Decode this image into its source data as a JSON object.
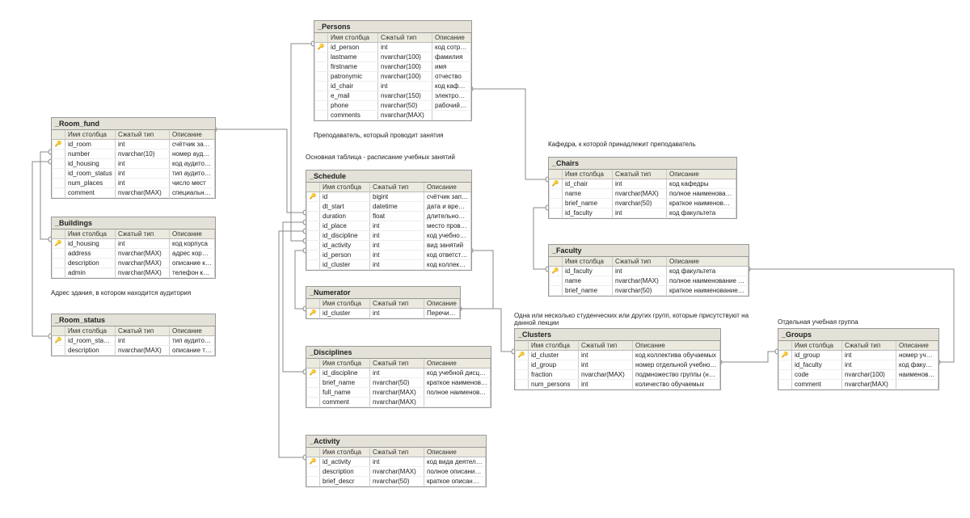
{
  "columns_header": {
    "name": "Имя столбца",
    "type": "Сжатый тип",
    "desc": "Описание"
  },
  "captions": {
    "buildings": "Адрес здания, в котором находится аудитория",
    "persons": "Преподаватель, который проводит занятия",
    "schedule": "Основная таблица - расписание учебных занятий",
    "chairs": "Кафедра, к которой принадлежит преподаватель",
    "clusters": "Одна или несколько студенческих или других групп, которые присутствуют на данной лекции",
    "groups": "Отдельная учебная группа"
  },
  "tables": {
    "room_fund": {
      "title": "_Room_fund",
      "rows": [
        {
          "pk": true,
          "name": "id_room",
          "type": "int",
          "desc": "счётчик записей"
        },
        {
          "pk": false,
          "name": "number",
          "type": "nvarchar(10)",
          "desc": "номер аудитории"
        },
        {
          "pk": false,
          "name": "id_housing",
          "type": "int",
          "desc": "код аудитории"
        },
        {
          "pk": false,
          "name": "id_room_status",
          "type": "int",
          "desc": "тип аудитории"
        },
        {
          "pk": false,
          "name": "num_places",
          "type": "int",
          "desc": "число мест"
        },
        {
          "pk": false,
          "name": "comment",
          "type": "nvarchar(MAX)",
          "desc": "специальное наи…"
        }
      ]
    },
    "buildings": {
      "title": "_Buildings",
      "rows": [
        {
          "pk": true,
          "name": "id_housing",
          "type": "int",
          "desc": "код корпуса"
        },
        {
          "pk": false,
          "name": "address",
          "type": "nvarchar(MAX)",
          "desc": "адрес корпуса"
        },
        {
          "pk": false,
          "name": "description",
          "type": "nvarchar(MAX)",
          "desc": "описание корпуса"
        },
        {
          "pk": false,
          "name": "admin",
          "type": "nvarchar(MAX)",
          "desc": "телефон коменданта или…"
        }
      ]
    },
    "room_status": {
      "title": "_Room_status",
      "rows": [
        {
          "pk": true,
          "name": "id_room_sta…",
          "type": "int",
          "desc": "тип аудитории"
        },
        {
          "pk": false,
          "name": "description",
          "type": "nvarchar(MAX)",
          "desc": "описание типа аудитории…"
        }
      ]
    },
    "persons": {
      "title": "_Persons",
      "rows": [
        {
          "pk": true,
          "name": "id_person",
          "type": "int",
          "desc": "код сотрудника"
        },
        {
          "pk": false,
          "name": "lastname",
          "type": "nvarchar(100)",
          "desc": "фамилия"
        },
        {
          "pk": false,
          "name": "firstname",
          "type": "nvarchar(100)",
          "desc": "имя"
        },
        {
          "pk": false,
          "name": "patronymic",
          "type": "nvarchar(100)",
          "desc": "отчество"
        },
        {
          "pk": false,
          "name": "id_chair",
          "type": "int",
          "desc": "код кафедры"
        },
        {
          "pk": false,
          "name": "e_mail",
          "type": "nvarchar(150)",
          "desc": "электронная почта"
        },
        {
          "pk": false,
          "name": "phone",
          "type": "nvarchar(50)",
          "desc": "рабочий телефон"
        },
        {
          "pk": false,
          "name": "comments",
          "type": "nvarchar(MAX)",
          "desc": ""
        }
      ]
    },
    "schedule": {
      "title": "_Schedule",
      "rows": [
        {
          "pk": true,
          "name": "id",
          "type": "bigint",
          "desc": "счётчик записей"
        },
        {
          "pk": false,
          "name": "dt_start",
          "type": "datetime",
          "desc": "дата и время проведения занят…"
        },
        {
          "pk": false,
          "name": "duration",
          "type": "float",
          "desc": "длительность занятия в академ…"
        },
        {
          "pk": false,
          "name": "id_place",
          "type": "int",
          "desc": "место проведения занятия"
        },
        {
          "pk": false,
          "name": "id_discipline",
          "type": "int",
          "desc": "код учебной дисциплины"
        },
        {
          "pk": false,
          "name": "id_activity",
          "type": "int",
          "desc": "вид занятий"
        },
        {
          "pk": false,
          "name": "id_person",
          "type": "int",
          "desc": "код ответственного лица (преп…"
        },
        {
          "pk": false,
          "name": "id_cluster",
          "type": "int",
          "desc": "код коллектива обучаемых"
        }
      ]
    },
    "numerator": {
      "title": "_Numerator",
      "rows": [
        {
          "pk": true,
          "name": "id_cluster",
          "type": "int",
          "desc": "Перечислитель кластеров"
        }
      ]
    },
    "disciplines": {
      "title": "_Disciplines",
      "rows": [
        {
          "pk": true,
          "name": "id_discipline",
          "type": "int",
          "desc": "код учебной дисциплины"
        },
        {
          "pk": false,
          "name": "brief_name",
          "type": "nvarchar(50)",
          "desc": "краткое наименование учебной дисциплин…"
        },
        {
          "pk": false,
          "name": "full_name",
          "type": "nvarchar(MAX)",
          "desc": "полное наименование учебной дисциплины"
        },
        {
          "pk": false,
          "name": "comment",
          "type": "nvarchar(MAX)",
          "desc": ""
        }
      ]
    },
    "activity": {
      "title": "_Activity",
      "rows": [
        {
          "pk": true,
          "name": "id_activity",
          "type": "int",
          "desc": "код вида деятельности"
        },
        {
          "pk": false,
          "name": "description",
          "type": "nvarchar(MAX)",
          "desc": "полное описание вида деятельности"
        },
        {
          "pk": false,
          "name": "brief_descr",
          "type": "nvarchar(50)",
          "desc": "краткое описание вида деятельно…"
        }
      ]
    },
    "chairs": {
      "title": "_Chairs",
      "rows": [
        {
          "pk": true,
          "name": "id_chair",
          "type": "int",
          "desc": "код кафедры"
        },
        {
          "pk": false,
          "name": "name",
          "type": "nvarchar(MAX)",
          "desc": "полное наименование кафедры"
        },
        {
          "pk": false,
          "name": "brief_name",
          "type": "nvarchar(50)",
          "desc": "краткое наименование кафедры"
        },
        {
          "pk": false,
          "name": "id_faculty",
          "type": "int",
          "desc": "код факультета"
        }
      ]
    },
    "faculty": {
      "title": "_Faculty",
      "rows": [
        {
          "pk": true,
          "name": "id_faculty",
          "type": "int",
          "desc": "код факультета"
        },
        {
          "pk": false,
          "name": "name",
          "type": "nvarchar(MAX)",
          "desc": "полное наименование факультета"
        },
        {
          "pk": false,
          "name": "brief_name",
          "type": "nvarchar(50)",
          "desc": "краткое наименование факультета"
        }
      ]
    },
    "clusters": {
      "title": "_Clusters",
      "rows": [
        {
          "pk": true,
          "name": "id_cluster",
          "type": "int",
          "desc": "код коллектива обучаемых"
        },
        {
          "pk": false,
          "name": "id_group",
          "type": "int",
          "desc": "номер отдельной учебной группы"
        },
        {
          "pk": false,
          "name": "fraction",
          "type": "nvarchar(MAX)",
          "desc": "подмножество группы (направление)"
        },
        {
          "pk": false,
          "name": "num_persons",
          "type": "int",
          "desc": "количество обучаемых"
        }
      ]
    },
    "groups": {
      "title": "_Groups",
      "rows": [
        {
          "pk": true,
          "name": "id_group",
          "type": "int",
          "desc": "номер учебной группы"
        },
        {
          "pk": false,
          "name": "id_faculty",
          "type": "int",
          "desc": "код факультета"
        },
        {
          "pk": false,
          "name": "code",
          "type": "nvarchar(100)",
          "desc": "наименование группы"
        },
        {
          "pk": false,
          "name": "comment",
          "type": "nvarchar(MAX)",
          "desc": ""
        }
      ]
    }
  }
}
